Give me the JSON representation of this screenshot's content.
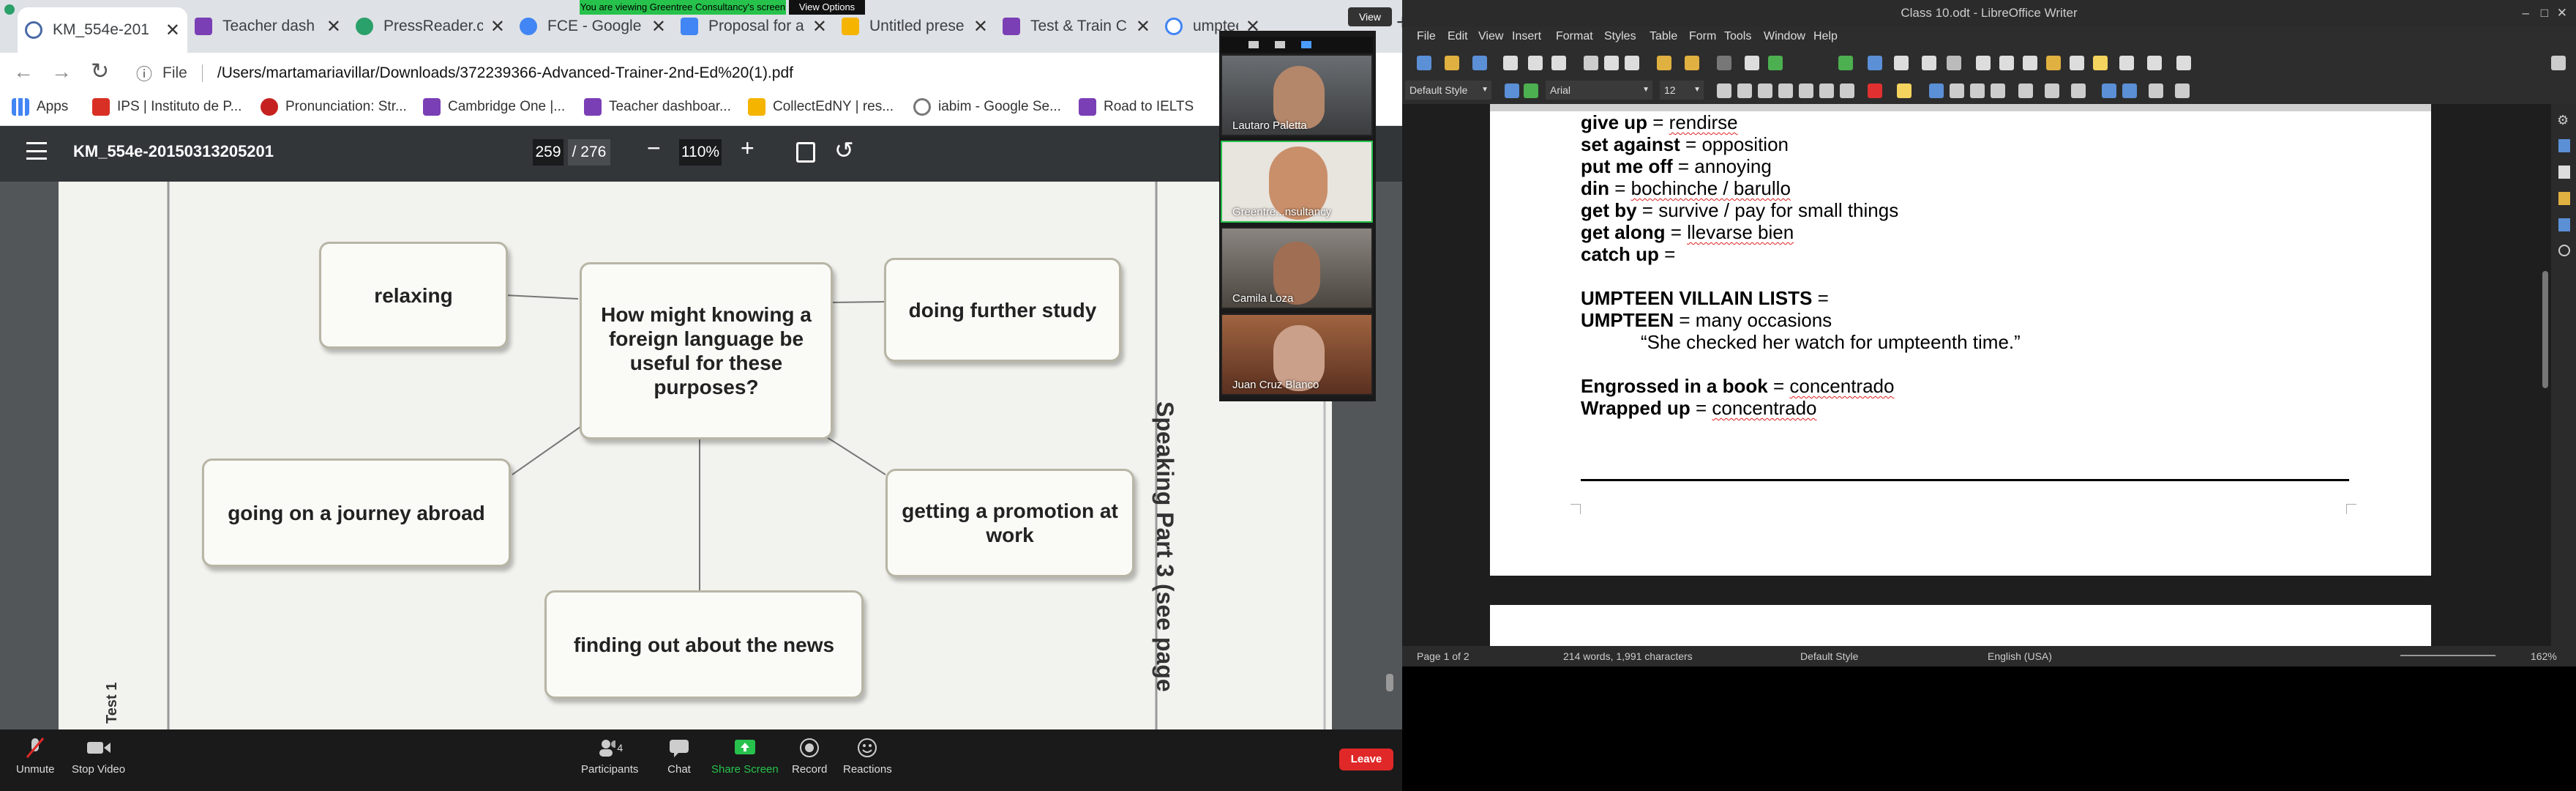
{
  "browser": {
    "tabs": [
      {
        "title": "KM_554e-201",
        "color": "#4a6aa5"
      },
      {
        "title": "Teacher dash",
        "color": "#7b3fb5"
      },
      {
        "title": "PressReader.c",
        "color": "#2aa06a"
      },
      {
        "title": "FCE - Google",
        "color": "#4285f4"
      },
      {
        "title": "Proposal for a",
        "color": "#4285f4"
      },
      {
        "title": "Untitled prese",
        "color": "#f4b400"
      },
      {
        "title": "Test & Train C",
        "color": "#7b3fb5"
      },
      {
        "title": "umpteenth -",
        "color": "#4285f4"
      }
    ],
    "new_tab": "+",
    "address_prefix": "File",
    "address": "/Users/martamariavillar/Downloads/372239366-Advanced-Trainer-2nd-Ed%20(1).pdf",
    "bookmarks": [
      {
        "label": "Apps",
        "color": "#4285f4"
      },
      {
        "label": "IPS | Instituto de P...",
        "color": "#d93025"
      },
      {
        "label": "Pronunciation: Str...",
        "color": "#c5221f"
      },
      {
        "label": "Cambridge One |...",
        "color": "#7b3fb5"
      },
      {
        "label": "Teacher dashboar...",
        "color": "#7b3fb5"
      },
      {
        "label": "CollectEdNY | res...",
        "color": "#f4b400"
      },
      {
        "label": "iabim - Google Se...",
        "color": "#777777"
      },
      {
        "label": "Road to IELTS",
        "color": "#7b3fb5"
      }
    ]
  },
  "pdf": {
    "title": "KM_554e-20150313205201",
    "page_current": "259",
    "page_total": "/ 276",
    "zoom": "110%",
    "diagram": {
      "center": "How might knowing a foreign language be useful for these purposes?",
      "relaxing": "relaxing",
      "further_study": "doing further study",
      "journey": "going on a journey abroad",
      "promotion": "getting a promotion at work",
      "news": "finding out about the news"
    },
    "side_text": "Speaking Part 3 (see page",
    "test_label": "Test 1"
  },
  "share_banner": {
    "text": "You are viewing Greentree Consultancy's screen",
    "options": "View Options"
  },
  "video_panel": {
    "view_label": "View",
    "participants": [
      "Lautaro Paletta",
      "Greentre...nsultancy",
      "Camila Loza",
      "Juan Cruz Blanco"
    ]
  },
  "zoom_controls": {
    "unmute": "Unmute",
    "stop_video": "Stop Video",
    "participants": "Participants",
    "participants_count": "4",
    "chat": "Chat",
    "share_screen": "Share Screen",
    "record": "Record",
    "reactions": "Reactions",
    "leave": "Leave"
  },
  "writer": {
    "title": "Class 10.odt - LibreOffice Writer",
    "menu": [
      "File",
      "Edit",
      "View",
      "Insert",
      "Format",
      "Styles",
      "Table",
      "Form",
      "Tools",
      "Window",
      "Help"
    ],
    "para_style": "Default Style",
    "font": "Arial",
    "size": "12",
    "lines": [
      {
        "b": "give up",
        "r": " = ",
        "u": "rendirse"
      },
      {
        "b": "set against",
        "r": " = opposition",
        "u": ""
      },
      {
        "b": "put me off",
        "r": " = annoying",
        "u": ""
      },
      {
        "b": "din",
        "r": " = ",
        "u": "bochinche / barullo"
      },
      {
        "b": "get by",
        "r": " = survive / pay for small things",
        "u": ""
      },
      {
        "b": "get along",
        "r": " = ",
        "u": "llevarse bien"
      },
      {
        "b": "catch up",
        "r": " = ",
        "u": ""
      },
      {
        "b": "UMPTEEN VILLAIN LISTS",
        "r": " =",
        "u": ""
      },
      {
        "b": "UMPTEEN",
        "r": " = many occasions",
        "u": ""
      },
      {
        "b": "",
        "r": "“She checked her watch for umpteenth time.”",
        "u": ""
      },
      {
        "b": "Engrossed in a book",
        "r": "  = ",
        "u": "concentrado"
      },
      {
        "b": "Wrapped up",
        "r": " = ",
        "u": "concentrado"
      }
    ],
    "status": {
      "page": "Page 1 of 2",
      "words": "214 words, 1,991 characters",
      "style": "Default Style",
      "lang": "English (USA)",
      "zoom": "162%"
    }
  }
}
